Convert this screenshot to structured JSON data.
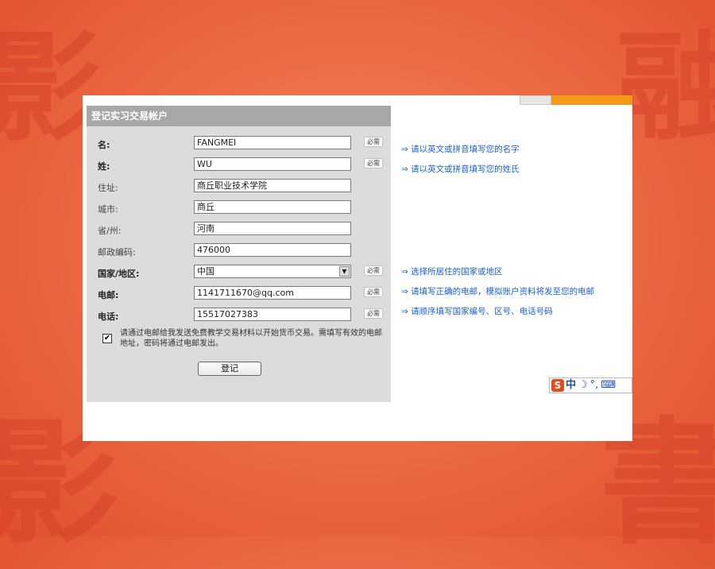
{
  "background": {
    "glyphs": [
      "影",
      "融",
      "影",
      "書"
    ]
  },
  "form": {
    "header": "登记实习交易帐户",
    "required_badge": "必需",
    "fields": [
      {
        "label": "名:",
        "value": "FANGMEI",
        "required": true,
        "hint": "⇒ 请以英文或拼音填写您的名字"
      },
      {
        "label": "姓:",
        "value": "WU",
        "required": true,
        "hint": "⇒ 请以英文或拼音填写您的姓氏"
      },
      {
        "label": "住址:",
        "value": "商丘职业技术学院",
        "required": false
      },
      {
        "label": "城市:",
        "value": "商丘",
        "required": false
      },
      {
        "label": "省/州:",
        "value": "河南",
        "required": false
      },
      {
        "label": "邮政编码:",
        "value": "476000",
        "required": false
      },
      {
        "label": "国家/地区:",
        "value": "中国",
        "required": true,
        "hint": "⇒ 选择所居住的国家或地区"
      },
      {
        "label": "电邮:",
        "value": "1141711670@qq.com",
        "required": true,
        "hint": "⇒ 请填写正确的电邮，模拟账户资料将发至您的电邮"
      },
      {
        "label": "电话:",
        "value": "15517027383",
        "required": true,
        "hint": "⇒ 请顺序填写国家编号、区号、电话号码"
      }
    ],
    "consent": {
      "checked": true,
      "text": "请通过电邮给我发送免费教学交易材料以开始货币交易。需填写有效的电邮地址，密码将通过电邮发出。"
    },
    "submit_label": "登记"
  },
  "ime_bar": {
    "logo": "S",
    "lang": "中",
    "moon": "☽",
    "punct": "°,",
    "keyboard": "⌨"
  },
  "colors": {
    "accent_hint": "#1a5fcf",
    "header_bg": "#a7a7a7",
    "panel_bg": "#dcdcdc",
    "slide_bg": "#ec6c44"
  }
}
